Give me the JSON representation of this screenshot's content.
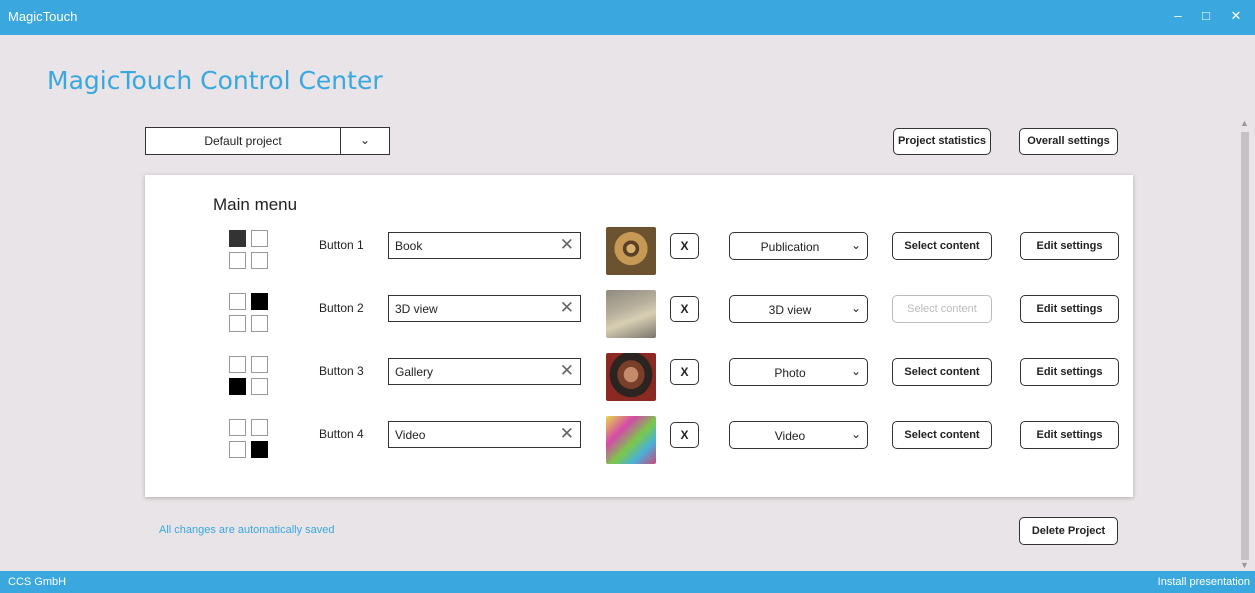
{
  "window": {
    "title": "MagicTouch",
    "minimize": "–",
    "maximize": "□",
    "close": "✕"
  },
  "header": {
    "title": "MagicTouch Control Center"
  },
  "project": {
    "selected": "Default project",
    "chevron": "⌄",
    "statistics_label": "Project statistics",
    "overall_settings_label": "Overall settings"
  },
  "main_menu": {
    "title": "Main menu",
    "rows": [
      {
        "label": "Button 1",
        "name": "Book",
        "clear": "✕",
        "x_label": "X",
        "type": "Publication",
        "chevron": "⌄",
        "select_label": "Select content",
        "edit_label": "Edit settings",
        "thumb_icon": "owl-image"
      },
      {
        "label": "Button 2",
        "name": "3D view",
        "clear": "✕",
        "x_label": "X",
        "type": "3D view",
        "chevron": "⌄",
        "select_label": "Select content",
        "edit_label": "Edit settings",
        "thumb_icon": "camera-image"
      },
      {
        "label": "Button 3",
        "name": "Gallery",
        "clear": "✕",
        "x_label": "X",
        "type": "Photo",
        "chevron": "⌄",
        "select_label": "Select content",
        "edit_label": "Edit settings",
        "thumb_icon": "portrait-image"
      },
      {
        "label": "Button 4",
        "name": "Video",
        "clear": "✕",
        "x_label": "X",
        "type": "Video",
        "chevron": "⌄",
        "select_label": "Select content",
        "edit_label": "Edit settings",
        "thumb_icon": "colorful-image"
      }
    ]
  },
  "footer": {
    "saved_note": "All changes are automatically saved",
    "delete_label": "Delete Project"
  },
  "statusbar": {
    "company": "CCS GmbH",
    "install": "Install presentation"
  },
  "colors": {
    "accent": "#3aa8df",
    "background": "#e8e4e7"
  }
}
